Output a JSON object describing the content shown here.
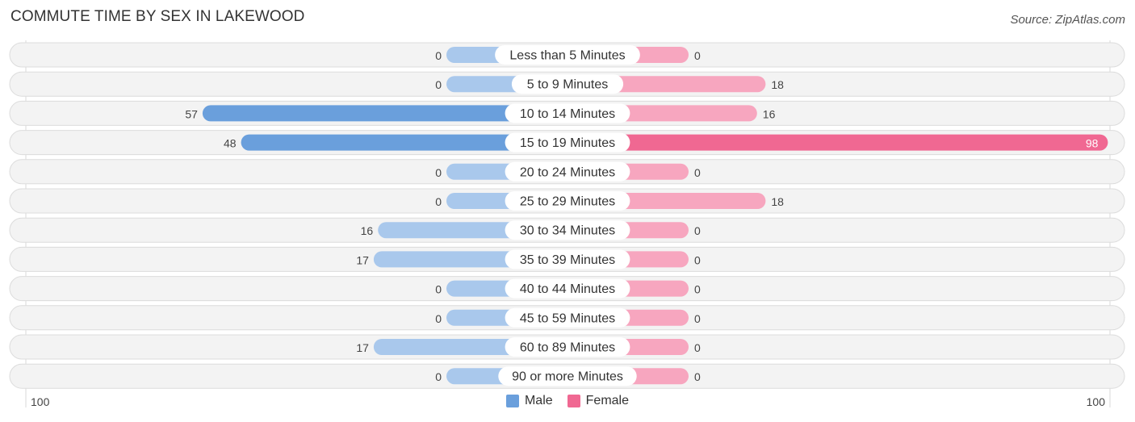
{
  "header": {
    "title": "COMMUTE TIME BY SEX IN LAKEWOOD",
    "source": "Source: ZipAtlas.com"
  },
  "legend": [
    {
      "name": "Male",
      "color": "#6a9fdc"
    },
    {
      "name": "Female",
      "color": "#f06892"
    }
  ],
  "colors": {
    "male_strong": "#6a9fdc",
    "male_light": "#a9c8ec",
    "female_strong": "#f06892",
    "female_light": "#f7a6bf"
  },
  "chart_data": {
    "type": "bar",
    "orientation": "horizontal-diverging",
    "title": "COMMUTE TIME BY SEX IN LAKEWOOD",
    "categories": [
      "Less than 5 Minutes",
      "5 to 9 Minutes",
      "10 to 14 Minutes",
      "15 to 19 Minutes",
      "20 to 24 Minutes",
      "25 to 29 Minutes",
      "30 to 34 Minutes",
      "35 to 39 Minutes",
      "40 to 44 Minutes",
      "45 to 59 Minutes",
      "60 to 89 Minutes",
      "90 or more Minutes"
    ],
    "series": [
      {
        "name": "Male",
        "values": [
          0,
          0,
          57,
          48,
          0,
          0,
          16,
          17,
          0,
          0,
          17,
          0
        ]
      },
      {
        "name": "Female",
        "values": [
          0,
          18,
          16,
          98,
          0,
          18,
          0,
          0,
          0,
          0,
          0,
          0
        ]
      }
    ],
    "axis": {
      "left_label": "100",
      "right_label": "100",
      "range": [
        0,
        100
      ]
    },
    "legend_position": "bottom-center",
    "grid": false
  }
}
